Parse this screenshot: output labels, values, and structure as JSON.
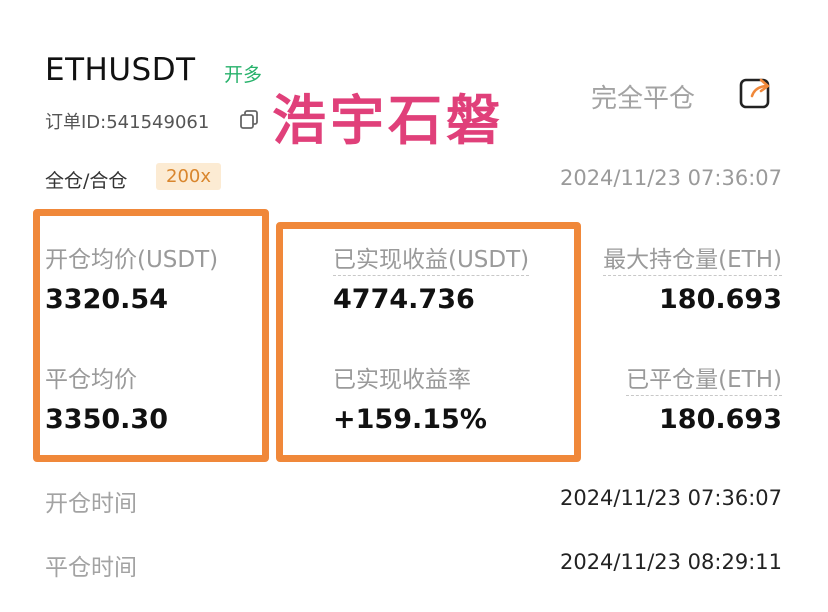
{
  "header": {
    "symbol": "ETHUSDT",
    "side": "开多",
    "watermark": "浩宇石磐",
    "close_all": "完全平仓",
    "order_id": "订单ID:541549061",
    "margin_mode": "全仓/合仓",
    "leverage": "200x",
    "time": "2024/11/23 07:36:07"
  },
  "stats": {
    "open_avg_label": "开仓均价(USDT)",
    "open_avg_value": "3320.54",
    "close_avg_label": "平仓均价",
    "close_avg_value": "3350.30",
    "realized_pnl_label": "已实现收益(USDT)",
    "realized_pnl_value": "4774.736",
    "realized_roi_label": "已实现收益率",
    "realized_roi_value": "+159.15%",
    "max_position_label": "最大持仓量(ETH)",
    "max_position_value": "180.693",
    "closed_qty_label": "已平仓量(ETH)",
    "closed_qty_value": "180.693"
  },
  "times": {
    "open_time_label": "开仓时间",
    "open_time_value": "2024/11/23 07:36:07",
    "close_time_label": "平仓时间",
    "close_time_value": "2024/11/23 08:29:11"
  },
  "colors": {
    "highlight_box": "#f0883a",
    "long_side": "#27b26b",
    "watermark": "#e0407a"
  },
  "icons": [
    "copy-icon",
    "share-icon"
  ]
}
